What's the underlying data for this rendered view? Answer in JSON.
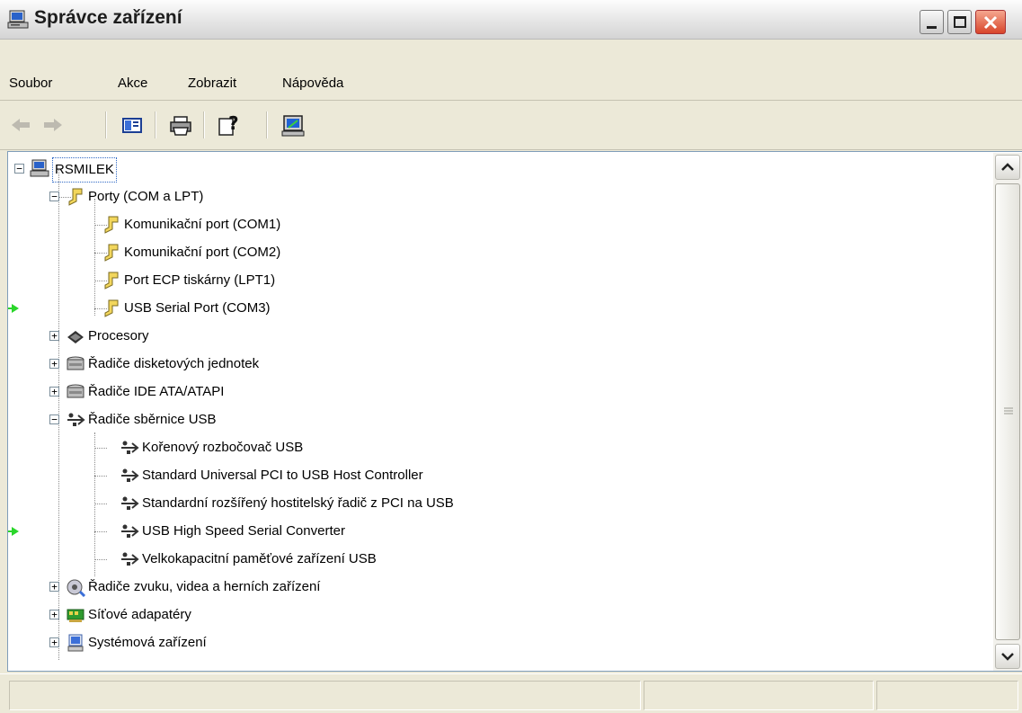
{
  "window": {
    "title": "Správce zařízení",
    "title_icon": "computer-icon",
    "buttons": [
      "minimize",
      "maximize",
      "close"
    ]
  },
  "menu": {
    "items": [
      {
        "label": "Soubor"
      },
      {
        "label": "Akce"
      },
      {
        "label": "Zobrazit"
      },
      {
        "label": "Nápověda"
      }
    ]
  },
  "toolbar": {
    "icons": [
      "back-arrow-icon",
      "forward-arrow-icon",
      "properties-view-icon",
      "print-icon",
      "help-icon",
      "scan-hardware-icon"
    ]
  },
  "tree": {
    "root": {
      "label": "RSMILEK",
      "icon": "computer-icon",
      "expanded": true
    },
    "nodes": [
      {
        "label": "Porty (COM a LPT)",
        "icon": "port-icon",
        "level": 1,
        "expanded": true
      },
      {
        "label": "Komunikační port (COM1)",
        "icon": "port-icon",
        "level": 2
      },
      {
        "label": "Komunikační port (COM2)",
        "icon": "port-icon",
        "level": 2
      },
      {
        "label": "Port ECP tiskárny (LPT1)",
        "icon": "port-icon",
        "level": 2
      },
      {
        "label": "USB Serial Port (COM3)",
        "icon": "port-icon",
        "level": 2,
        "marked": true
      },
      {
        "label": "Procesory",
        "icon": "processor-icon",
        "level": 1,
        "expanded": false
      },
      {
        "label": "Řadiče disketových jednotek",
        "icon": "disk-controller-icon",
        "level": 1,
        "expanded": false
      },
      {
        "label": "Řadiče IDE ATA/ATAPI",
        "icon": "disk-controller-icon",
        "level": 1,
        "expanded": false
      },
      {
        "label": "Řadiče sběrnice USB",
        "icon": "usb-icon",
        "level": 1,
        "expanded": true
      },
      {
        "label": "Kořenový rozbočovač USB",
        "icon": "usb-icon",
        "level": 2
      },
      {
        "label": "Standard Universal PCI to USB Host Controller",
        "icon": "usb-icon",
        "level": 2
      },
      {
        "label": "Standardní rozšířený hostitelský řadič z PCI na USB",
        "icon": "usb-icon",
        "level": 2
      },
      {
        "label": "USB High Speed Serial Converter",
        "icon": "usb-icon",
        "level": 2,
        "marked": true
      },
      {
        "label": "Velkokapacitní paměťové zařízení USB",
        "icon": "usb-icon",
        "level": 2
      },
      {
        "label": "Řadiče zvuku, videa a herních zařízení",
        "icon": "sound-icon",
        "level": 1,
        "expanded": false
      },
      {
        "label": "Síťové adapatéry",
        "icon": "network-adapter-icon",
        "level": 1,
        "expanded": false
      },
      {
        "label": "Systémová zařízení",
        "icon": "system-device-icon",
        "level": 1,
        "expanded": false
      }
    ]
  },
  "colors": {
    "marker_arrow": "#2ad62a",
    "selection_border": "#316ac5",
    "close_button": "#d8452a"
  }
}
